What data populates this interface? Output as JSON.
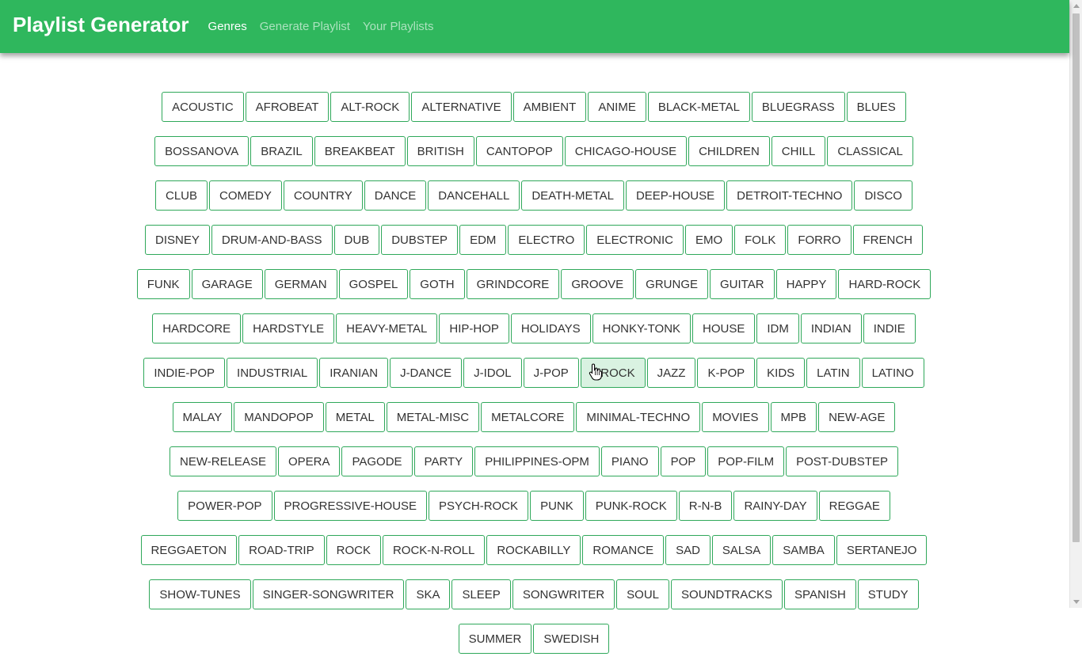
{
  "app": {
    "title": "Playlist Generator"
  },
  "nav": {
    "items": [
      {
        "label": "Genres",
        "active": true
      },
      {
        "label": "Generate Playlist",
        "active": false
      },
      {
        "label": "Your Playlists",
        "active": false
      }
    ]
  },
  "colors": {
    "navbar_bg": "#2fb75d",
    "button_border": "#2fa85a",
    "hover_bg": "#d9f2e1"
  },
  "genres": [
    "ACOUSTIC",
    "AFROBEAT",
    "ALT-ROCK",
    "ALTERNATIVE",
    "AMBIENT",
    "ANIME",
    "BLACK-METAL",
    "BLUEGRASS",
    "BLUES",
    "BOSSANOVA",
    "BRAZIL",
    "BREAKBEAT",
    "BRITISH",
    "CANTOPOP",
    "CHICAGO-HOUSE",
    "CHILDREN",
    "CHILL",
    "CLASSICAL",
    "CLUB",
    "COMEDY",
    "COUNTRY",
    "DANCE",
    "DANCEHALL",
    "DEATH-METAL",
    "DEEP-HOUSE",
    "DETROIT-TECHNO",
    "DISCO",
    "DISNEY",
    "DRUM-AND-BASS",
    "DUB",
    "DUBSTEP",
    "EDM",
    "ELECTRO",
    "ELECTRONIC",
    "EMO",
    "FOLK",
    "FORRO",
    "FRENCH",
    "FUNK",
    "GARAGE",
    "GERMAN",
    "GOSPEL",
    "GOTH",
    "GRINDCORE",
    "GROOVE",
    "GRUNGE",
    "GUITAR",
    "HAPPY",
    "HARD-ROCK",
    "HARDCORE",
    "HARDSTYLE",
    "HEAVY-METAL",
    "HIP-HOP",
    "HOLIDAYS",
    "HONKY-TONK",
    "HOUSE",
    "IDM",
    "INDIAN",
    "INDIE",
    "INDIE-POP",
    "INDUSTRIAL",
    "IRANIAN",
    "J-DANCE",
    "J-IDOL",
    "J-POP",
    "J-ROCK",
    "JAZZ",
    "K-POP",
    "KIDS",
    "LATIN",
    "LATINO",
    "MALAY",
    "MANDOPOP",
    "METAL",
    "METAL-MISC",
    "METALCORE",
    "MINIMAL-TECHNO",
    "MOVIES",
    "MPB",
    "NEW-AGE",
    "NEW-RELEASE",
    "OPERA",
    "PAGODE",
    "PARTY",
    "PHILIPPINES-OPM",
    "PIANO",
    "POP",
    "POP-FILM",
    "POST-DUBSTEP",
    "POWER-POP",
    "PROGRESSIVE-HOUSE",
    "PSYCH-ROCK",
    "PUNK",
    "PUNK-ROCK",
    "R-N-B",
    "RAINY-DAY",
    "REGGAE",
    "REGGAETON",
    "ROAD-TRIP",
    "ROCK",
    "ROCK-N-ROLL",
    "ROCKABILLY",
    "ROMANCE",
    "SAD",
    "SALSA",
    "SAMBA",
    "SERTANEJO",
    "SHOW-TUNES",
    "SINGER-SONGWRITER",
    "SKA",
    "SLEEP",
    "SONGWRITER",
    "SOUL",
    "SOUNDTRACKS",
    "SPANISH",
    "STUDY",
    "SUMMER",
    "SWEDISH"
  ],
  "hovered_genre": "J-ROCK",
  "icons": {
    "cursor": "hand-pointer-icon"
  }
}
